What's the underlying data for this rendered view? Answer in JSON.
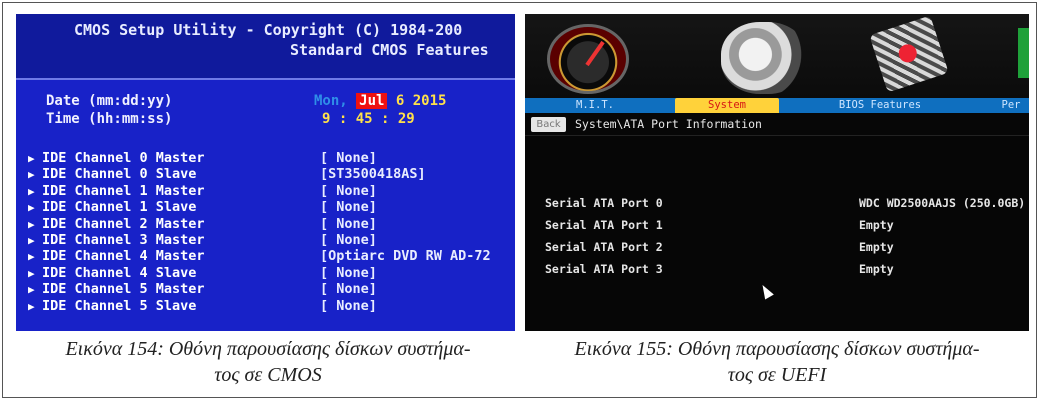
{
  "cmos": {
    "title_line1": "CMOS Setup Utility - Copyright (C) 1984-200",
    "title_line2": "Standard CMOS Features",
    "date_label": "Date (mm:dd:yy)",
    "time_label": "Time (hh:mm:ss)",
    "date_dow": "Mon,",
    "date_month": "Jul",
    "date_day_year": "6 2015",
    "time_value": "9 : 45 : 29",
    "channels": [
      {
        "label": "IDE Channel 0 Master",
        "value": "[ None]"
      },
      {
        "label": "IDE Channel 0 Slave",
        "value": "[ST3500418AS]"
      },
      {
        "label": "IDE Channel 1 Master",
        "value": "[ None]"
      },
      {
        "label": "IDE Channel 1 Slave",
        "value": "[ None]"
      },
      {
        "label": "IDE Channel 2 Master",
        "value": "[ None]"
      },
      {
        "label": "IDE Channel 3 Master",
        "value": "[ None]"
      },
      {
        "label": "IDE Channel 4 Master",
        "value": "[Optiarc DVD RW AD-72"
      },
      {
        "label": "IDE Channel 4 Slave",
        "value": "[ None]"
      },
      {
        "label": "IDE Channel 5 Master",
        "value": "[ None]"
      },
      {
        "label": "IDE Channel 5 Slave",
        "value": "[ None]"
      }
    ],
    "colors": {
      "background": "#1822c8",
      "highlight_month": "#e11111",
      "value_yellow": "#ffe14a"
    }
  },
  "uefi": {
    "top_icons": [
      "speedometer-icon",
      "gears-icon",
      "chip-icon",
      "green-panel-icon"
    ],
    "tabs": [
      {
        "label": "M.I.T.",
        "active": false
      },
      {
        "label": "System",
        "active": true
      },
      {
        "label": "BIOS Features",
        "active": false
      },
      {
        "label": "Per",
        "active": false
      }
    ],
    "back_label": "Back",
    "breadcrumb": "System\\ATA Port Information",
    "ports": [
      {
        "label": "Serial ATA Port 0",
        "value": "WDC WD2500AAJS (250.0GB)"
      },
      {
        "label": "Serial ATA Port 1",
        "value": "Empty"
      },
      {
        "label": "Serial ATA Port 2",
        "value": "Empty"
      },
      {
        "label": "Serial ATA Port 3",
        "value": "Empty"
      }
    ],
    "colors": {
      "tab_bar": "#0f6fbf",
      "active_tab": "#ffd23a",
      "active_tab_text": "#d61414"
    }
  },
  "captions": {
    "left": "Εικόνα 154: Οθόνη παρουσίασης δίσκων συστήμα-τος σε CMOS",
    "left_line1": "Εικόνα 154: Οθόνη παρουσίασης δίσκων συστήμα-",
    "left_line2": "τος σε CMOS",
    "right_line1": "Εικόνα 155: Οθόνη παρουσίασης δίσκων συστήμα-",
    "right_line2": "τος σε UEFI"
  }
}
